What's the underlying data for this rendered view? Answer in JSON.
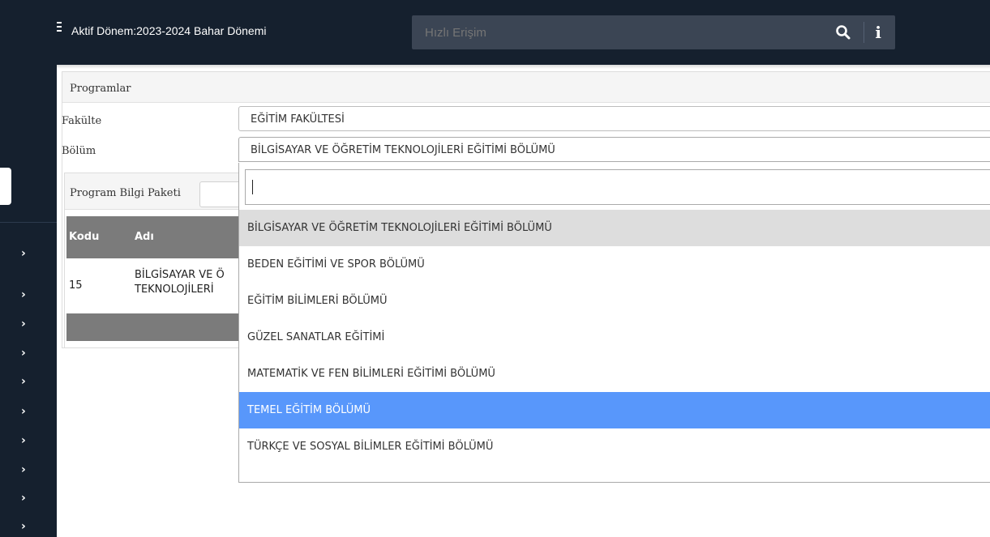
{
  "topbar": {
    "active_term": "Aktif Dönem:2023-2024 Bahar Dönemi",
    "quick_access_placeholder": "Hızlı Erişim",
    "search_icon": "search-icon",
    "info_icon": "info-icon",
    "info_glyph": "i"
  },
  "sidebar": {
    "chevron": "›",
    "item_count": 11
  },
  "panel": {
    "title": "Programlar",
    "faculty_label": "Fakülte",
    "faculty_value": "EĞİTİM FAKÜLTESİ",
    "department_label": "Bölüm",
    "department_value": "BİLGİSAYAR VE ÖĞRETİM TEKNOLOJİLERİ EĞİTİMİ BÖLÜMÜ"
  },
  "subpanel": {
    "title": "Program Bilgi Paketi",
    "table": {
      "columns": [
        "Kodu",
        "Adı"
      ],
      "rows": [
        {
          "code": "15",
          "name": "BİLGİSAYAR VE Ö\nTEKNOLOJİLERİ"
        }
      ]
    }
  },
  "dropdown": {
    "search_value": "",
    "options": [
      "BİLGİSAYAR VE ÖĞRETİM TEKNOLOJİLERİ EĞİTİMİ BÖLÜMÜ",
      "BEDEN EĞİTİMİ VE SPOR BÖLÜMÜ",
      "EĞİTİM BİLİMLERİ BÖLÜMÜ",
      "GÜZEL SANATLAR EĞİTİMİ",
      "MATEMATİK VE FEN BİLİMLERİ EĞİTİMİ BÖLÜMÜ",
      "TEMEL EĞİTİM BÖLÜMÜ",
      "TÜRKÇE VE SOSYAL BİLİMLER EĞİTİMİ BÖLÜMÜ"
    ],
    "selected_index": 0,
    "highlighted_index": 5
  },
  "colors": {
    "dark_bg": "#15202e",
    "highlight": "#5897fb",
    "selected": "#dddddd"
  }
}
